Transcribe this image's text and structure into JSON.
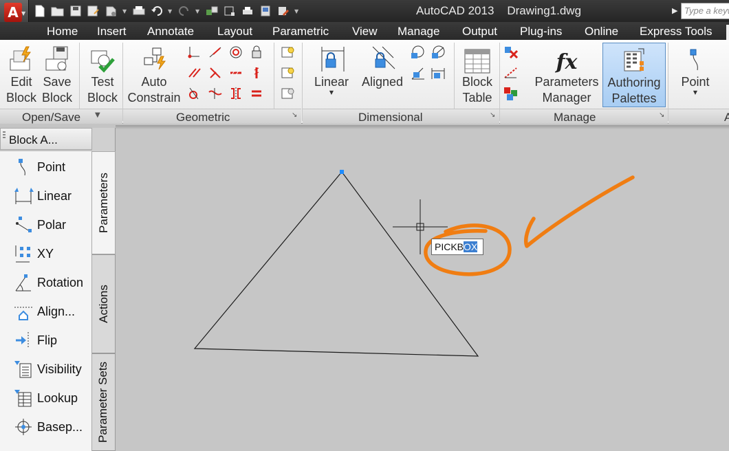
{
  "app": {
    "title": "AutoCAD 2013",
    "document": "Drawing1.dwg",
    "logo_letter": "A"
  },
  "search": {
    "placeholder": "Type a keyword or phrase"
  },
  "quick_access": [
    {
      "icon": "new-icon"
    },
    {
      "icon": "open-icon"
    },
    {
      "icon": "save-icon"
    },
    {
      "icon": "save-as-icon"
    },
    {
      "icon": "publish-icon"
    },
    {
      "icon": "plot-icon"
    },
    {
      "icon": "undo-icon"
    },
    {
      "icon": "redo-icon"
    },
    {
      "icon": "match-properties-icon"
    },
    {
      "icon": "block-icon"
    },
    {
      "icon": "print-preview-icon"
    },
    {
      "icon": "sheet-icon"
    },
    {
      "icon": "customize-icon"
    }
  ],
  "ribbon_tabs": [
    "Home",
    "Insert",
    "Annotate",
    "Layout",
    "Parametric",
    "View",
    "Manage",
    "Output",
    "Plug-ins",
    "Online",
    "Express Tools"
  ],
  "panels": {
    "open_save": {
      "title": "Open/Save",
      "edit_block": "Edit Block",
      "save_block": "Save Block"
    },
    "geometric": {
      "title": "Geometric",
      "test_block": "Test Block",
      "auto_constrain": "Auto Constrain"
    },
    "dimensional": {
      "title": "Dimensional",
      "linear": "Linear",
      "aligned": "Aligned",
      "block_table": "Block Table"
    },
    "manage": {
      "title": "Manage",
      "parameters_manager": "Parameters Manager",
      "authoring_palettes": "Authoring Palettes"
    },
    "action_params": {
      "title": "A",
      "point": "Point"
    }
  },
  "palette": {
    "title": "Block A...",
    "tools": [
      "Point",
      "Linear",
      "Polar",
      "XY",
      "Rotation",
      "Align...",
      "Flip",
      "Visibility",
      "Lookup",
      "Basep..."
    ],
    "tabs": [
      "Parameters",
      "Actions",
      "Parameter Sets"
    ],
    "active_tab": "Parameters"
  },
  "dynamic_input": {
    "typed": "PICKB",
    "selected": "OX"
  },
  "colors": {
    "annotation": "#f07d12",
    "highlight": "#3c7fd1",
    "canvas": "#c6c6c6"
  }
}
